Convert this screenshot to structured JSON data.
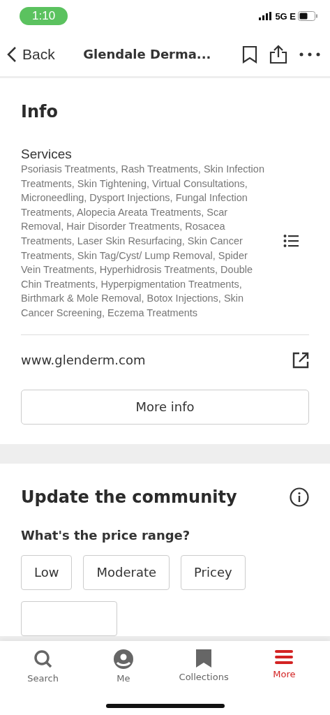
{
  "status_bar": {
    "time": "1:10",
    "network": "5G E"
  },
  "nav": {
    "back": "Back",
    "title": "Glendale Derma..."
  },
  "info": {
    "heading": "Info",
    "services_label": "Services",
    "services": "Psoriasis Treatments, Rash Treatments, Skin Infection Treatments, Skin Tightening, Virtual Consultations, Microneedling, Dysport Injections, Fungal Infection Treatments, Alopecia Areata Treatments, Scar Removal, Hair Disorder Treatments, Rosacea Treatments, Laser Skin Resurfacing, Skin Cancer Treatments, Skin Tag/Cyst/ Lump Removal, Spider Vein Treatments, Hyperhidrosis Treatments, Double Chin Treatments, Hyperpigmentation Treatments, Birthmark & Mole Removal, Botox Injections, Skin Cancer Screening, Eczema Treatments",
    "website": "www.glenderm.com",
    "more_info": "More info"
  },
  "community": {
    "heading": "Update the community",
    "question": "What's the price range?",
    "options": [
      {
        "label": "Low",
        "selected": false
      },
      {
        "label": "Moderate",
        "selected": false
      },
      {
        "label": "Pricey",
        "selected": false
      }
    ]
  },
  "tab_bar": [
    {
      "label": "Search",
      "kind": "search",
      "selected": false
    },
    {
      "label": "Me",
      "kind": "me",
      "selected": false
    },
    {
      "label": "Collections",
      "kind": "collections",
      "selected": false
    },
    {
      "label": "More",
      "kind": "more",
      "selected": true
    }
  ]
}
